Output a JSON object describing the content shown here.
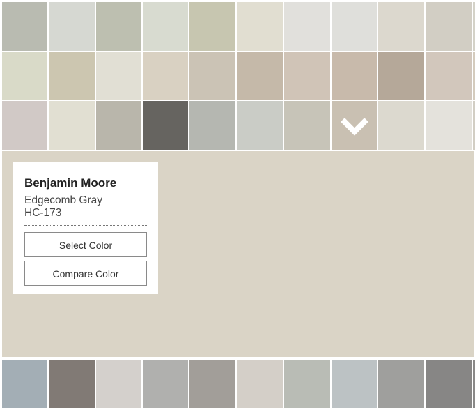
{
  "palette": {
    "rows": [
      [
        "#b9bbb1",
        "#d6d8d2",
        "#bdbfb0",
        "#d8dbd0",
        "#c7c6b0",
        "#e1ded1",
        "#e1e0dc",
        "#dfdfdb",
        "#dcd8ce",
        "#d2cec4",
        "#d4d2c8"
      ],
      [
        "#d9dac8",
        "#ccc6b0",
        "#e1dfd4",
        "#d9d1c2",
        "#cbc3b5",
        "#c5b9a9",
        "#d0c4b7",
        "#c8baab",
        "#b5a899",
        "#d2c7bc",
        "#d4cbbd"
      ],
      [
        "#d1c9c6",
        "#e1dfd2",
        "#b9b6ab",
        "#666460",
        "#b5b7b1",
        "#caccc6",
        "#c7c4b8",
        "#c9c0b2",
        "#dcd9cf",
        "#e4e2dc",
        "#d2cec4"
      ]
    ],
    "bottom_row": [
      "#a3aeb5",
      "#817a75",
      "#d4d0cc",
      "#b0b0ae",
      "#a29e99",
      "#d4cfc8",
      "#b9bcb5",
      "#bcc2c4",
      "#9f9f9d",
      "#878685",
      "#8a8988"
    ],
    "selected_icon": "chevron-down-icon"
  },
  "preview": {
    "color": "#dad4c6"
  },
  "card": {
    "brand": "Benjamin Moore",
    "color_name": "Edgecomb Gray",
    "color_code": "HC-173",
    "select_label": "Select Color",
    "compare_label": "Compare Color"
  }
}
